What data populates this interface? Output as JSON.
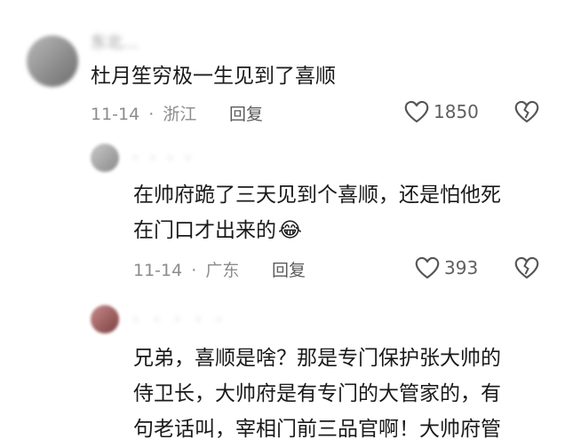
{
  "comments": [
    {
      "username": "东北…",
      "text_lines": [
        "杜月笙穷极一生见到了喜顺"
      ],
      "date": "11-14",
      "separator": "·",
      "location": "浙江",
      "reply_label": "回复",
      "likes": "1850"
    },
    {
      "username": "· · · ·",
      "text_lines": [
        "在帅府跪了三天见到个喜顺，还是怕他死",
        "在门口才出来的"
      ],
      "emoji": "😂",
      "date": "11-14",
      "separator": "·",
      "location": "广东",
      "reply_label": "回复",
      "likes": "393"
    },
    {
      "username": "· · · · ·",
      "text_lines": [
        "兄弟，喜顺是啥？那是专门保护张大帅的",
        "侍卫长，大帅府是有专门的大管家的，有",
        "句老话叫，宰相门前三品官啊！大帅府管"
      ]
    }
  ],
  "icons": {
    "like": "heart-outline-icon",
    "dislike": "broken-heart-icon"
  },
  "colors": {
    "text": "#1a1a1a",
    "meta": "#8c8c8c",
    "icon": "#555555"
  }
}
